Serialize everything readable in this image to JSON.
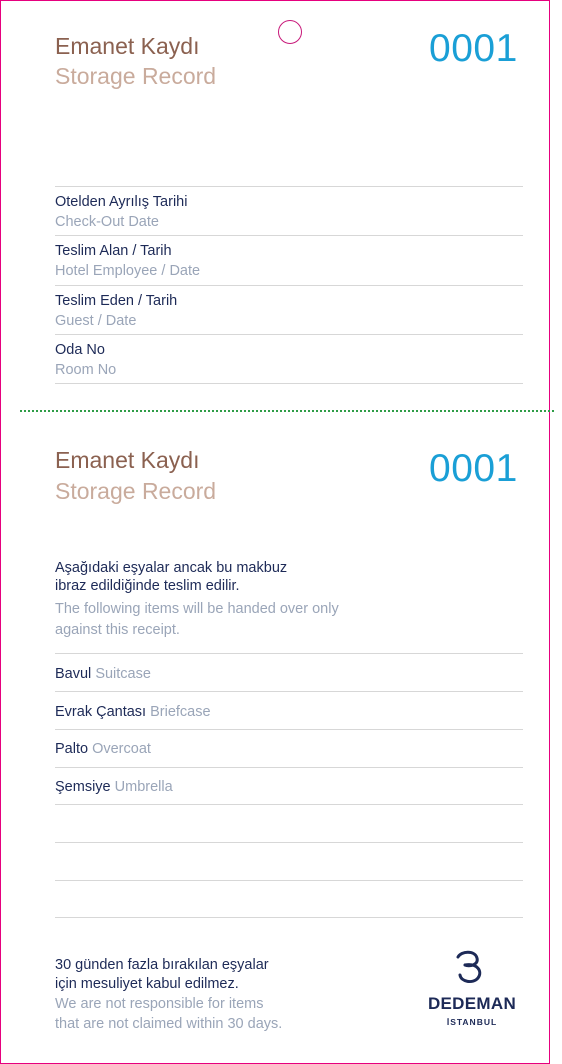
{
  "stub": {
    "title_tr": "Emanet Kaydı",
    "title_en": "Storage Record",
    "number": "0001",
    "fields": [
      {
        "tr": "Otelden Ayrılış Tarihi",
        "en": "Check-Out Date"
      },
      {
        "tr": "Teslim Alan / Tarih",
        "en": "Hotel Employee / Date"
      },
      {
        "tr": "Teslim Eden / Tarih",
        "en": "Guest / Date"
      },
      {
        "tr": "Oda No",
        "en": "Room No"
      }
    ]
  },
  "receipt": {
    "title_tr": "Emanet Kaydı",
    "title_en": "Storage Record",
    "number": "0001",
    "note_tr_1": "Aşağıdaki eşyalar ancak bu makbuz",
    "note_tr_2": "ibraz edildiğinde teslim edilir.",
    "note_en_1": "The following items will be handed over only",
    "note_en_2": "against this receipt.",
    "items": [
      {
        "tr": "Bavul",
        "en": "Suitcase"
      },
      {
        "tr": "Evrak Çantası",
        "en": "Briefcase"
      },
      {
        "tr": "Palto",
        "en": "Overcoat"
      },
      {
        "tr": "Şemsiye",
        "en": "Umbrella"
      }
    ],
    "footer_tr_1": "30 günden fazla bırakılan eşyalar",
    "footer_tr_2": "için mesuliyet kabul edilmez.",
    "footer_en_1": "We are not responsible for items",
    "footer_en_2": "that are not claimed within 30 days."
  },
  "logo": {
    "name": "DEDEMAN",
    "city": "İSTANBUL",
    "icon": "dedeman-logo-icon"
  },
  "colors": {
    "border": "#e6007e",
    "number": "#1a9fd6",
    "title_tr": "#8b6150",
    "title_en": "#c9ab9c",
    "text_dark": "#1d2a57",
    "text_light": "#9aa5b8",
    "perforation": "#2e9d47"
  }
}
